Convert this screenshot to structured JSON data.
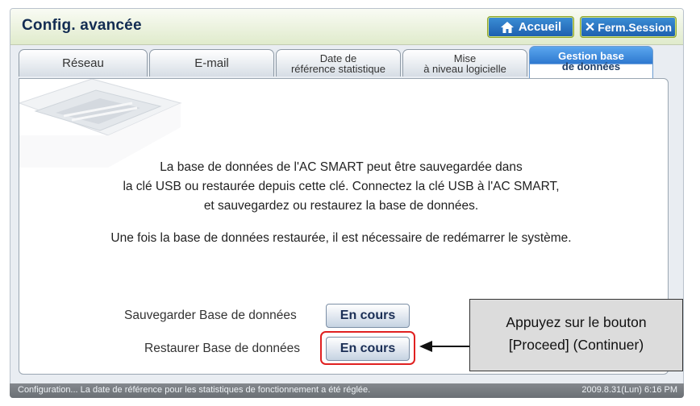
{
  "header": {
    "title": "Config. avancée",
    "home_label": "Accueil",
    "logout_label": "Ferm.Session"
  },
  "tabs": [
    {
      "line1": "Réseau",
      "line2": ""
    },
    {
      "line1": "E-mail",
      "line2": ""
    },
    {
      "line1": "Date de",
      "line2": "référence statistique"
    },
    {
      "line1": "Mise",
      "line2": "à niveau logicielle"
    },
    {
      "line1": "Gestion base",
      "line2": "de données",
      "active": true
    }
  ],
  "main": {
    "description": [
      "La base de données de l'AC SMART peut être sauvegardée dans",
      "la clé USB ou restaurée depuis cette clé.  Connectez la clé USB à l'AC SMART,",
      "et sauvegardez ou restaurez la base de données."
    ],
    "note": "Une fois la base de données restaurée, il est nécessaire de redémarrer le système.",
    "backup_label": "Sauvegarder Base de données",
    "backup_button": "En cours",
    "restore_label": "Restaurer Base de données",
    "restore_button": "En cours"
  },
  "callout": {
    "line1": "Appuyez sur le bouton",
    "line2": "[Proceed] (Continuer)"
  },
  "status": {
    "message": "Configuration... La date de référence pour les statistiques de fonctionnement a été réglée.",
    "datetime": "2009.8.31(Lun)  6:16 PM"
  },
  "colors": {
    "accent": "#2e78cf",
    "highlight": "#e02020",
    "header_bg": "#e0ebcc"
  }
}
